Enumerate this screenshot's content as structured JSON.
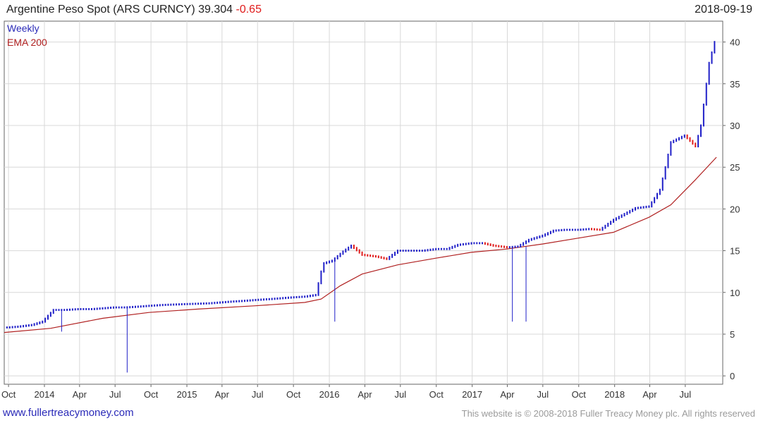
{
  "header": {
    "title": "Argentine Peso Spot (ARS CURNCY)",
    "last": "39.304",
    "change": "-0.65",
    "date": "2018-09-19"
  },
  "footer": {
    "site": "www.fullertreacymoney.com",
    "copyright": "This website is © 2008-2018 Fuller Treacy Money plc. All rights reserved"
  },
  "colors": {
    "up": "#1f1fc8",
    "down": "#e01b1b",
    "ema": "#b02020",
    "grid": "#d8d8d8",
    "frame": "#666666"
  },
  "chart_data": {
    "type": "line",
    "legend": {
      "placement": "top-left",
      "items": [
        "Weekly",
        "EMA 200"
      ]
    },
    "x_tick_labels": [
      "Oct",
      "2014",
      "Apr",
      "Jul",
      "Oct",
      "2015",
      "Apr",
      "Jul",
      "Oct",
      "2016",
      "Apr",
      "Jul",
      "Oct",
      "2017",
      "Apr",
      "Jul",
      "Oct",
      "2018",
      "Apr",
      "Jul"
    ],
    "y_ticks": [
      0,
      5,
      10,
      15,
      20,
      25,
      30,
      35,
      40
    ],
    "ylim": [
      -1,
      42.5
    ],
    "xlim": [
      "2013-09-20",
      "2018-10-05"
    ],
    "grid": true,
    "series": [
      {
        "name": "Weekly",
        "kind": "price",
        "x": [
          "2013-09-27",
          "2013-10-25",
          "2013-11-29",
          "2013-12-27",
          "2014-01-24",
          "2014-02-21",
          "2014-03-28",
          "2014-05-02",
          "2014-05-30",
          "2014-06-27",
          "2014-07-25",
          "2014-08-29",
          "2014-09-26",
          "2014-10-31",
          "2014-11-28",
          "2014-12-26",
          "2015-01-30",
          "2015-02-27",
          "2015-03-27",
          "2015-04-24",
          "2015-05-29",
          "2015-06-26",
          "2015-07-31",
          "2015-08-28",
          "2015-09-25",
          "2015-10-30",
          "2015-11-27",
          "2015-12-11",
          "2015-12-18",
          "2016-01-08",
          "2016-02-05",
          "2016-02-26",
          "2016-03-25",
          "2016-04-29",
          "2016-05-27",
          "2016-06-24",
          "2016-07-29",
          "2016-08-26",
          "2016-09-30",
          "2016-10-28",
          "2016-11-25",
          "2016-12-30",
          "2017-01-27",
          "2017-02-24",
          "2017-03-31",
          "2017-04-28",
          "2017-05-26",
          "2017-06-30",
          "2017-07-28",
          "2017-08-25",
          "2017-09-29",
          "2017-10-27",
          "2017-11-24",
          "2017-12-29",
          "2018-01-26",
          "2018-02-23",
          "2018-03-30",
          "2018-04-27",
          "2018-05-11",
          "2018-05-25",
          "2018-06-29",
          "2018-07-27",
          "2018-08-10",
          "2018-08-31",
          "2018-09-14",
          "2018-09-19"
        ],
        "values": [
          5.8,
          5.9,
          6.1,
          6.5,
          7.9,
          7.9,
          8.0,
          8.0,
          8.1,
          8.2,
          8.2,
          8.3,
          8.4,
          8.5,
          8.55,
          8.6,
          8.65,
          8.7,
          8.8,
          8.9,
          9.0,
          9.1,
          9.2,
          9.3,
          9.4,
          9.5,
          9.7,
          12.5,
          13.5,
          13.8,
          14.9,
          15.6,
          14.5,
          14.3,
          14.0,
          15.0,
          15.0,
          15.0,
          15.2,
          15.2,
          15.7,
          15.9,
          15.9,
          15.6,
          15.4,
          15.5,
          16.3,
          16.8,
          17.4,
          17.5,
          17.5,
          17.6,
          17.5,
          18.7,
          19.4,
          20.1,
          20.3,
          22.3,
          25.0,
          28.0,
          28.8,
          27.5,
          30.0,
          37.5,
          40.0,
          39.3
        ],
        "spikes": [
          {
            "x": "2014-02-14",
            "low": 5.3
          },
          {
            "x": "2014-08-01",
            "low": 0.4
          },
          {
            "x": "2016-01-15",
            "low": 6.5
          },
          {
            "x": "2017-04-14",
            "low": 6.5
          },
          {
            "x": "2017-05-19",
            "low": 6.5
          }
        ]
      },
      {
        "name": "EMA 200",
        "kind": "line",
        "x": [
          "2013-09-20",
          "2014-01-17",
          "2014-05-30",
          "2014-09-26",
          "2015-01-30",
          "2015-06-26",
          "2015-10-30",
          "2015-12-11",
          "2016-01-29",
          "2016-03-25",
          "2016-06-24",
          "2016-09-30",
          "2016-12-30",
          "2017-03-31",
          "2017-06-30",
          "2017-09-29",
          "2017-12-29",
          "2018-03-30",
          "2018-05-25",
          "2018-07-27",
          "2018-09-19"
        ],
        "values": [
          5.2,
          5.7,
          6.9,
          7.6,
          8.0,
          8.4,
          8.8,
          9.2,
          10.8,
          12.2,
          13.3,
          14.1,
          14.8,
          15.2,
          15.8,
          16.5,
          17.2,
          19.0,
          20.5,
          23.5,
          26.2
        ]
      }
    ]
  }
}
